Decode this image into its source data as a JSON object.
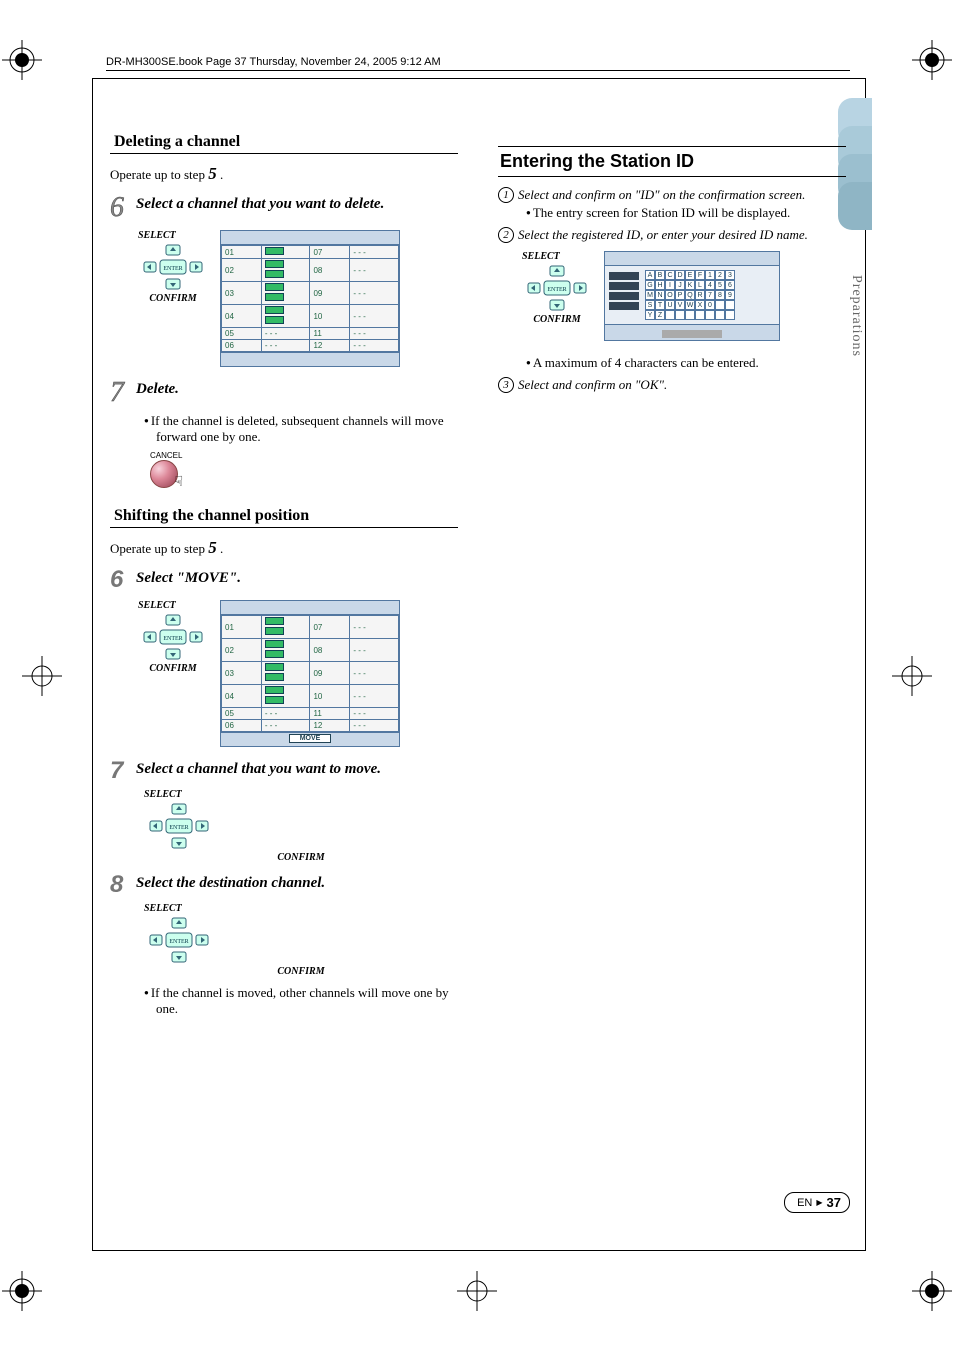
{
  "header_line": "DR-MH300SE.book  Page 37  Thursday, November 24, 2005  9:12 AM",
  "side_label": "Preparations",
  "left": {
    "section1_title": "Deleting a channel",
    "operate_up_to": "Operate up to step ",
    "operate_num": "5",
    "operate_period": ".",
    "step6_num": "6",
    "step6_label": "Select a channel that you want to delete.",
    "step7_num": "7",
    "step7_label": "Delete.",
    "step7_bullet": "If the channel is deleted, subsequent channels will move forward one by one.",
    "cancel_label": "CANCEL",
    "section2_title": "Shifting the channel position",
    "s2_step6_label": "Select \"MOVE\".",
    "s2_step7_label": "Select a channel that you want to move.",
    "s2_step8_num": "8",
    "s2_step8_label": "Select the destination channel.",
    "s2_bullet": "If the channel is moved, other channels will move one by one.",
    "fig_select": "SELECT",
    "fig_confirm": "CONFIRM",
    "enter_label": "ENTER",
    "move_btn": "MOVE",
    "channels_left": [
      "01",
      "02",
      "03",
      "04",
      "05",
      "06"
    ],
    "channels_right": [
      "07",
      "08",
      "09",
      "10",
      "11",
      "12"
    ],
    "dash": "- - -"
  },
  "right": {
    "title": "Entering the Station ID",
    "step1_num": "1",
    "step1_text": "Select and confirm on \"ID\" on the confirmation screen.",
    "step1_bullet": "The entry screen for Station ID will be displayed.",
    "step2_num": "2",
    "step2_text": "Select the registered ID, or enter your desired ID name.",
    "bullet2": "A maximum of 4 characters can be entered.",
    "step3_num": "3",
    "step3_text": "Select and confirm on \"OK\".",
    "fig_select": "SELECT",
    "fig_confirm": "CONFIRM",
    "id_chars": [
      "A",
      "B",
      "C",
      "D",
      "E",
      "F",
      "1",
      "2",
      "3",
      "G",
      "H",
      "I",
      "J",
      "K",
      "L",
      "4",
      "5",
      "6",
      "M",
      "N",
      "O",
      "P",
      "Q",
      "R",
      "7",
      "8",
      "9",
      "S",
      "T",
      "U",
      "V",
      "W",
      "X",
      "0",
      "",
      "",
      "Y",
      "Z",
      "",
      "",
      "",
      "",
      "",
      "",
      ""
    ]
  },
  "footer": {
    "lang": "EN",
    "page": "37"
  }
}
